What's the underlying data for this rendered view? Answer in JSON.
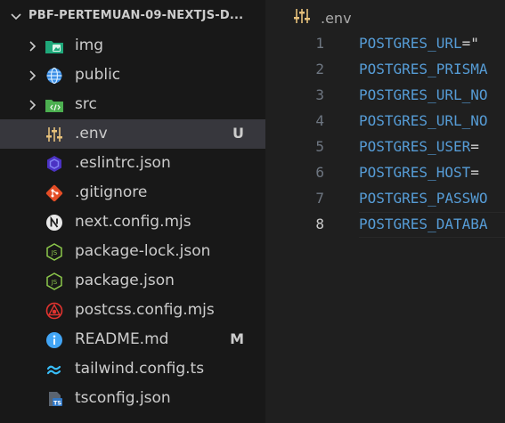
{
  "explorer": {
    "title": "PBF-PERTEMUAN-09-NEXTJS-D...",
    "items": [
      {
        "label": "img",
        "icon": "image-folder-icon",
        "type": "folder",
        "badge": ""
      },
      {
        "label": "public",
        "icon": "globe-folder-icon",
        "type": "folder",
        "badge": ""
      },
      {
        "label": "src",
        "icon": "source-folder-icon",
        "type": "folder",
        "badge": ""
      },
      {
        "label": ".env",
        "icon": "settings-sliders-icon",
        "type": "file",
        "badge": "U",
        "selected": true
      },
      {
        "label": ".eslintrc.json",
        "icon": "eslint-icon",
        "type": "file",
        "badge": ""
      },
      {
        "label": ".gitignore",
        "icon": "git-icon",
        "type": "file",
        "badge": ""
      },
      {
        "label": "next.config.mjs",
        "icon": "nextjs-icon",
        "type": "file",
        "badge": ""
      },
      {
        "label": "package-lock.json",
        "icon": "nodejs-icon",
        "type": "file",
        "badge": ""
      },
      {
        "label": "package.json",
        "icon": "nodejs-icon",
        "type": "file",
        "badge": ""
      },
      {
        "label": "postcss.config.mjs",
        "icon": "postcss-icon",
        "type": "file",
        "badge": ""
      },
      {
        "label": "README.md",
        "icon": "info-icon",
        "type": "file",
        "badge": "M"
      },
      {
        "label": "tailwind.config.ts",
        "icon": "tailwind-icon",
        "type": "file",
        "badge": ""
      },
      {
        "label": "tsconfig.json",
        "icon": "typescript-config-icon",
        "type": "file",
        "badge": ""
      }
    ]
  },
  "editor": {
    "breadcrumb": ".env",
    "active_line": 8,
    "lines": [
      {
        "num": "1",
        "key": "POSTGRES_URL",
        "rest": "=\""
      },
      {
        "num": "2",
        "key": "POSTGRES_PRISMA",
        "rest": ""
      },
      {
        "num": "3",
        "key": "POSTGRES_URL_NO",
        "rest": ""
      },
      {
        "num": "4",
        "key": "POSTGRES_URL_NO",
        "rest": ""
      },
      {
        "num": "5",
        "key": "POSTGRES_USER",
        "rest": "="
      },
      {
        "num": "6",
        "key": "POSTGRES_HOST",
        "rest": "="
      },
      {
        "num": "7",
        "key": "POSTGRES_PASSWO",
        "rest": ""
      },
      {
        "num": "8",
        "key": "POSTGRES_DATABA",
        "rest": ""
      }
    ]
  },
  "colors": {
    "sidebar_bg": "#181818",
    "editor_bg": "#1f1f1f",
    "selection": "#37373d",
    "env_key": "#569cd6"
  }
}
